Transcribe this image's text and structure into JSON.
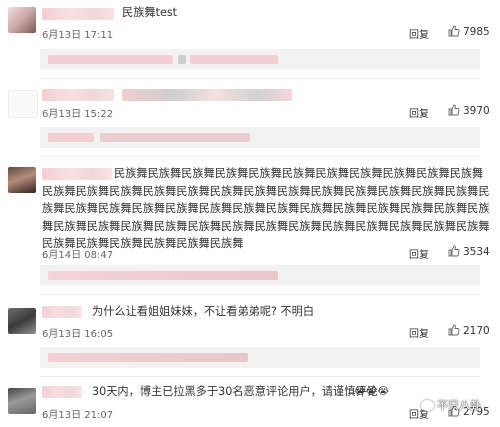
{
  "reply_label": "回复",
  "comments": [
    {
      "text": "民族舞test",
      "time": "6月13日 17:11",
      "likes": "7985"
    },
    {
      "text": "",
      "time": "6月13日 15:22",
      "likes": "3970"
    },
    {
      "text": "民族舞民族舞民族舞民族舞民族舞民族舞民族舞民族舞民族舞民族舞民族舞民族舞民族舞民族舞民族舞民族舞民族舞民族舞民族舞民族舞民族舞民族舞民族舞民族舞民族舞民族舞民族舞民族舞民族舞民族舞民族舞民族舞民族舞民族舞民族舞民族舞民族舞民族舞民族舞民族舞民族舞民族舞民族舞民族舞民族舞民族舞民族舞民族舞民族舞民族舞民族舞民族舞民族舞民族舞民族舞民族舞民族舞",
      "time": "6月14日 08:47",
      "likes": "3534"
    },
    {
      "text": "为什么让看姐姐妹妹，不让看弟弟呢? 不明白",
      "time": "6月13日 16:05",
      "likes": "2170"
    },
    {
      "text": "30天内，博主已拉黑多于30名恶意评论用户，请谨慎评论",
      "time": "6月13日 21:07",
      "likes": "2795"
    }
  ],
  "watermark": "不只八卦"
}
